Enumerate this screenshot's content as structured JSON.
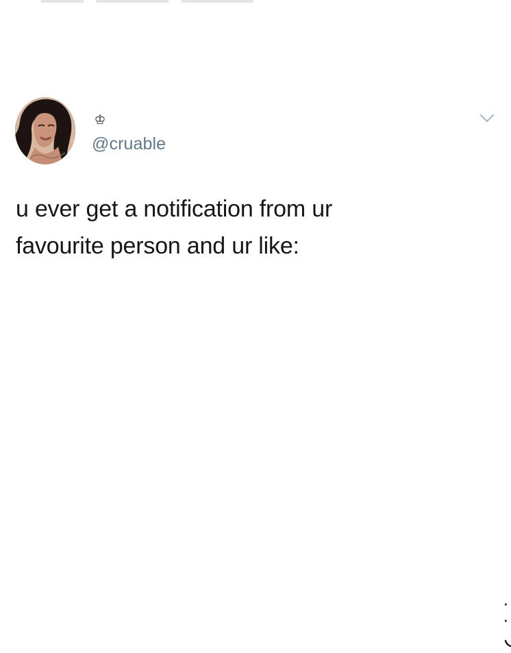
{
  "tweet": {
    "badge": "♔",
    "handle": "@cruable",
    "text_line_1": "u ever get a notification from ur",
    "text_line_2": "favourite person and ur like:",
    "eyes": "· ·"
  },
  "icons": {
    "menu": "chevron-down-icon",
    "badge": "crown-icon",
    "emoticon": "smile-face-icon"
  },
  "colors": {
    "text": "#14171a",
    "secondary": "#657786",
    "icon_gray": "#aab8c2",
    "background": "#ffffff"
  }
}
